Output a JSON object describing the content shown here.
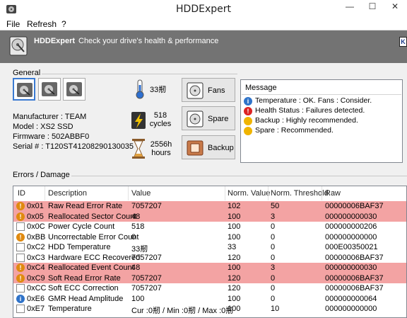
{
  "window": {
    "title": "HDDExpert"
  },
  "menu": [
    "File",
    "Refresh",
    "?"
  ],
  "banner": {
    "brand": "HDDExpert",
    "tagline": "Check your drive's health & performance",
    "corner_glyph": "K"
  },
  "general": {
    "label": "General",
    "manufacturer": "Manufacturer : TEAM",
    "model": "Model : XS2 SSD",
    "firmware": "Firmware : 502ABBF0",
    "serial": "Serial # : T120ST41208290130035",
    "temperature": "33剏",
    "cycles": "518",
    "cycles_unit": "cycles",
    "hours": "2556h",
    "hours_unit": "hours"
  },
  "actions": {
    "fans": "Fans",
    "spare": "Spare",
    "backup": "Backup"
  },
  "message": {
    "title": "Message",
    "items": [
      {
        "icon": "info-icon",
        "text": "Temperature : OK. Fans : Consider."
      },
      {
        "icon": "error-icon",
        "text": "Health Status : Failures detected."
      },
      {
        "icon": "bulb-icon",
        "text": "Backup : Highly recommended."
      },
      {
        "icon": "bulb-icon",
        "text": "Spare : Recommended."
      }
    ]
  },
  "errors": {
    "label": "Errors / Damage",
    "columns": [
      "ID",
      "Description",
      "Value",
      "Norm. Value",
      "Norm. Threshold",
      "Raw"
    ],
    "rows": [
      {
        "icon": "warning-icon",
        "warn": true,
        "id": "0x01",
        "desc": "Raw Read Error Rate",
        "value": "7057207",
        "norm": "102",
        "thr": "50",
        "raw": "00000006BAF37"
      },
      {
        "icon": "warning-icon",
        "warn": true,
        "id": "0x05",
        "desc": "Reallocated Sector Count",
        "value": "48",
        "norm": "100",
        "thr": "3",
        "raw": "000000000030"
      },
      {
        "icon": "hourglass-icon",
        "warn": false,
        "id": "0x0C",
        "desc": "Power Cycle Count",
        "value": "518",
        "norm": "100",
        "thr": "0",
        "raw": "000000000206"
      },
      {
        "icon": "warning-icon",
        "warn": false,
        "id": "0xBB",
        "desc": "Uncorrectable Error Count",
        "value": "0",
        "norm": "100",
        "thr": "0",
        "raw": "000000000000"
      },
      {
        "icon": "thermometer-icon",
        "warn": false,
        "id": "0xC2",
        "desc": "HDD Temperature",
        "value": "33剏",
        "norm": "33",
        "thr": "0",
        "raw": "000E00350021"
      },
      {
        "icon": "medkit-icon",
        "warn": false,
        "id": "0xC3",
        "desc": "Hardware ECC Recovered",
        "value": "7057207",
        "norm": "120",
        "thr": "0",
        "raw": "00000006BAF37"
      },
      {
        "icon": "warning-icon",
        "warn": true,
        "id": "0xC4",
        "desc": "Reallocated Event Count",
        "value": "48",
        "norm": "100",
        "thr": "3",
        "raw": "000000000030"
      },
      {
        "icon": "warning-icon",
        "warn": true,
        "id": "0xC9",
        "desc": "Soft Read Error Rate",
        "value": "7057207",
        "norm": "120",
        "thr": "0",
        "raw": "00000006BAF37"
      },
      {
        "icon": "medkit-icon",
        "warn": false,
        "id": "0xCC",
        "desc": "Soft ECC Correction",
        "value": "7057207",
        "norm": "120",
        "thr": "0",
        "raw": "00000006BAF37"
      },
      {
        "icon": "info-icon",
        "warn": false,
        "id": "0xE6",
        "desc": "GMR Head Amplitude",
        "value": "100",
        "norm": "100",
        "thr": "0",
        "raw": "000000000064"
      },
      {
        "icon": "thermometer-icon",
        "warn": false,
        "id": "0xE7",
        "desc": "Temperature",
        "value": "Cur :0剏 / Min :0剏 / Max :0剏",
        "norm": "100",
        "thr": "10",
        "raw": "000000000000"
      }
    ]
  },
  "colors": {
    "banner": "#737373",
    "warn_row": "#f3a3a3",
    "selected_border": "#3b7bd2"
  }
}
